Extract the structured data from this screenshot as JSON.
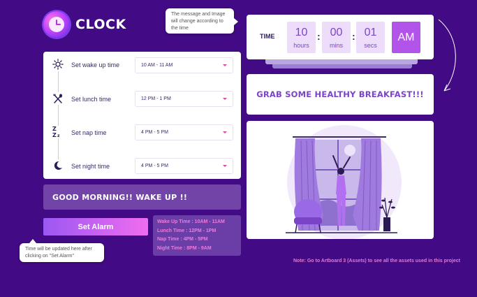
{
  "app": {
    "title": "CLOCK"
  },
  "tooltips": {
    "top": "The message and Image will change according to the time",
    "bottom": "Time will be updated here after clicking on \"Set Alarm\""
  },
  "settings": {
    "rows": [
      {
        "icon": "sun-icon",
        "label": "Set wake up time",
        "value": "10 AM - 11 AM"
      },
      {
        "icon": "utensils-icon",
        "label": "Set lunch time",
        "value": "12 PM - 1 PM"
      },
      {
        "icon": "zzz-icon",
        "label": "Set nap time",
        "value": "4 PM - 5 PM"
      },
      {
        "icon": "moon-icon",
        "label": "Set night time",
        "value": "4 PM - 5 PM"
      }
    ]
  },
  "greeting": "GOOD MORNING!! WAKE UP !!",
  "set_alarm_label": "Set Alarm",
  "schedule": [
    "Wake Up Time : 10AM - 11AM",
    "Lunch Time : 12PM - 1PM",
    "Nap Time : 4PM - 5PM",
    "Night Time : 8PM - 9AM"
  ],
  "clock": {
    "label": "TIME",
    "hours": "10",
    "hours_unit": "hours",
    "mins": "00",
    "mins_unit": "mins",
    "secs": "01",
    "secs_unit": "secs",
    "meridiem": "AM"
  },
  "message": "GRAB SOME HEALTHY BREAKFAST!!!",
  "note": "Note: Go to Artboard 3 (Assets)  to see all the assets used in this project",
  "colors": {
    "background": "#420a84",
    "accent": "#b253ea",
    "message": "#7b44c8"
  }
}
